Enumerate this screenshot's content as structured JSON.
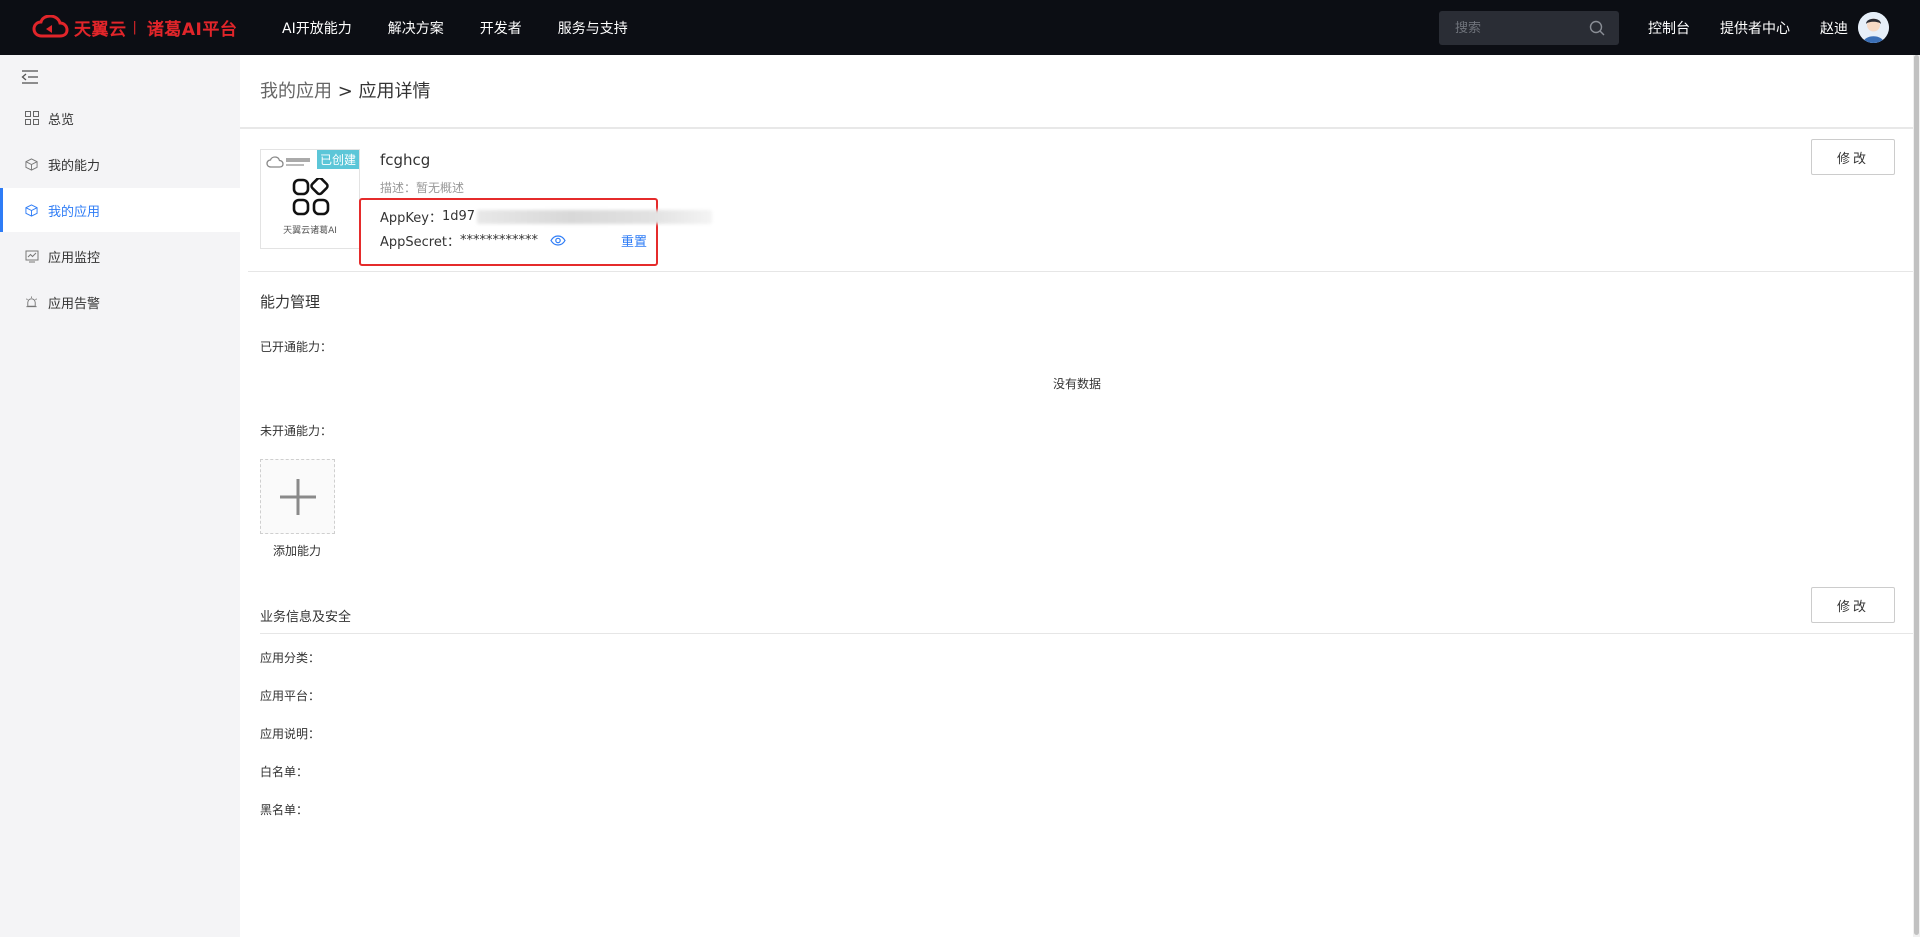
{
  "header": {
    "logo_text": "天翼云",
    "logo_sub": "诸葛AI平台",
    "nav": [
      "AI开放能力",
      "解决方案",
      "开发者",
      "服务与支持"
    ],
    "search_placeholder": "搜索",
    "console": "控制台",
    "provider_center": "提供者中心",
    "username": "赵迪"
  },
  "sidebar": {
    "items": [
      {
        "label": "总览",
        "icon": "overview-icon"
      },
      {
        "label": "我的能力",
        "icon": "cube-icon"
      },
      {
        "label": "我的应用",
        "icon": "app-icon",
        "active": true
      },
      {
        "label": "应用监控",
        "icon": "monitor-icon"
      },
      {
        "label": "应用告警",
        "icon": "alarm-icon"
      }
    ]
  },
  "breadcrumb": {
    "parent": "我的应用",
    "separator": " > ",
    "current": "应用详情"
  },
  "app": {
    "badge": "已创建",
    "logo_caption": "天翼云诸葛AI",
    "name": "fcghcg",
    "desc_label": "描述：",
    "desc_value": "暂无概述",
    "appkey_label": "AppKey：",
    "appkey_value": "1d97",
    "appsecret_label": "AppSecret：",
    "appsecret_value": "************",
    "reset": "重置",
    "edit": "修改"
  },
  "capability": {
    "title": "能力管理",
    "opened_label": "已开通能力：",
    "no_data": "没有数据",
    "unopened_label": "未开通能力：",
    "add_label": "添加能力"
  },
  "business": {
    "title": "业务信息及安全",
    "edit": "修改",
    "fields": [
      "应用分类：",
      "应用平台：",
      "应用说明：",
      "白名单：",
      "黑名单："
    ]
  },
  "colors": {
    "topbar": "#0c0e14",
    "brand_red": "#e1252a",
    "accent_blue": "#2e7cf6",
    "badge": "#5cc6d8",
    "highlight_box": "#e52b2b"
  }
}
